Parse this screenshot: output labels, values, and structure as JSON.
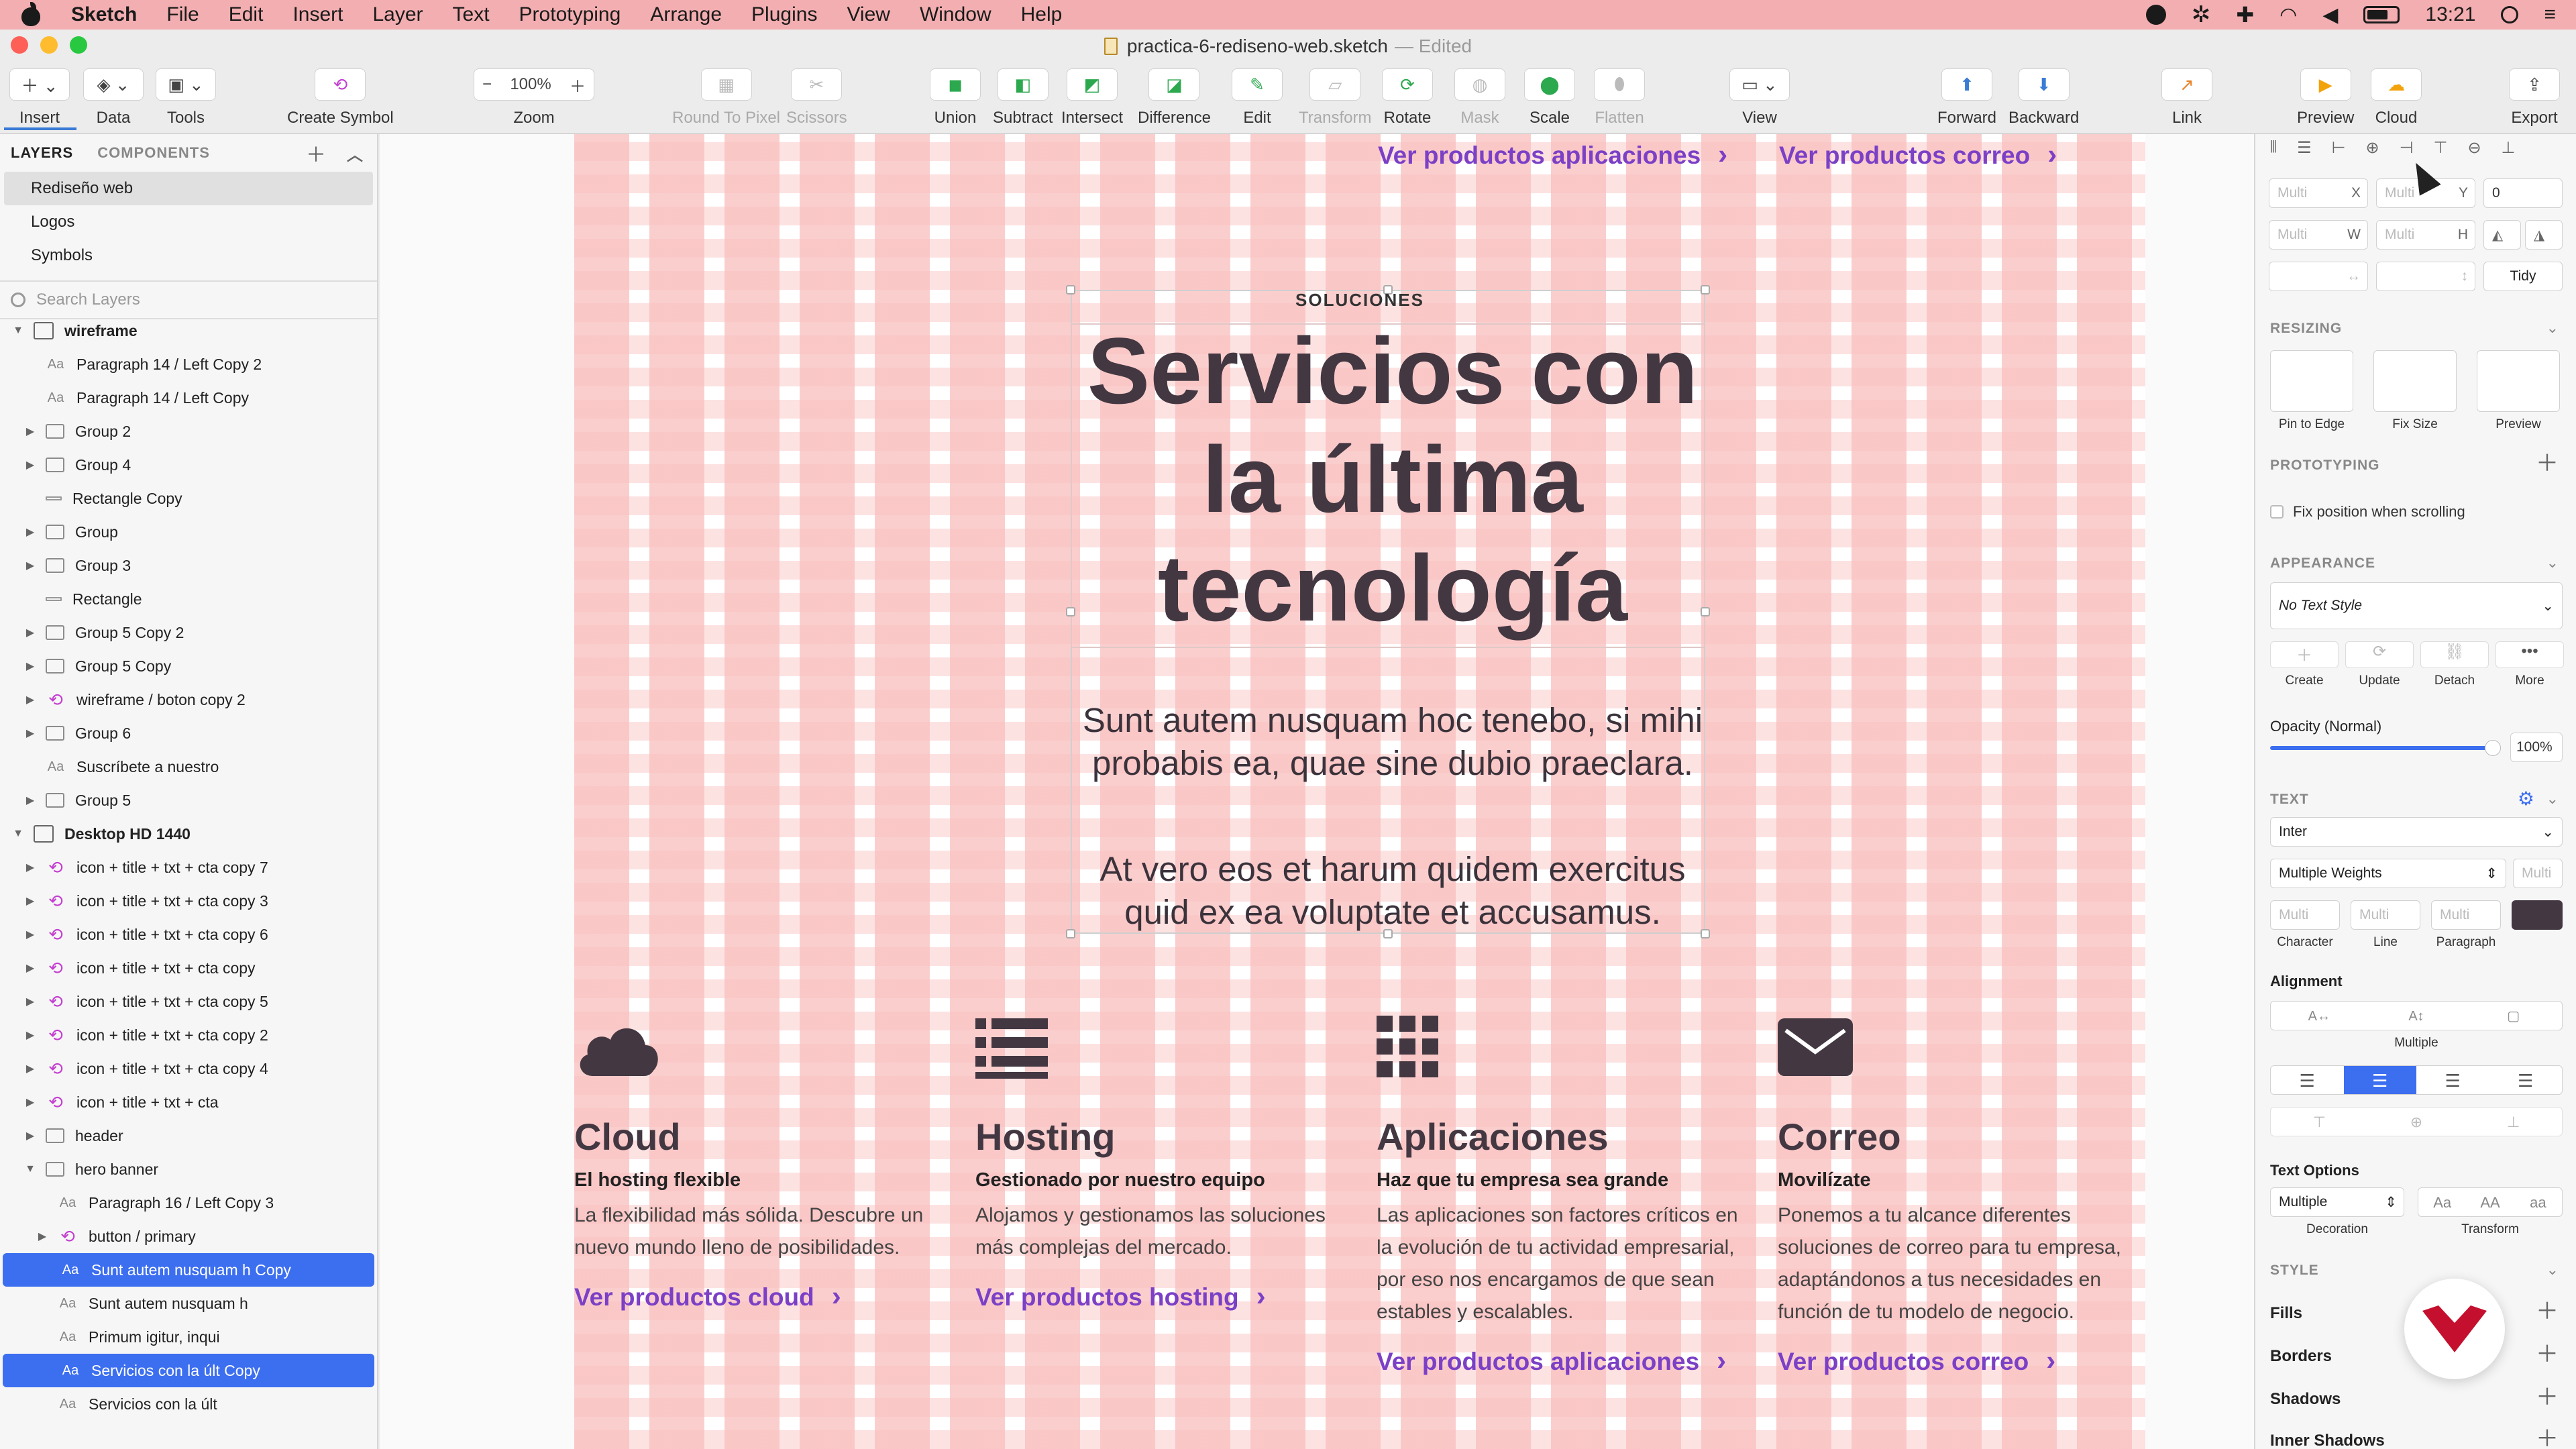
{
  "menubar": {
    "app": "Sketch",
    "items": [
      "File",
      "Edit",
      "Insert",
      "Layer",
      "Text",
      "Prototyping",
      "Arrange",
      "Plugins",
      "View",
      "Window",
      "Help"
    ],
    "time": "13:21"
  },
  "titlebar": {
    "filename": "practica-6-rediseno-web.sketch",
    "state": "— Edited"
  },
  "toolbar": {
    "insert": "Insert",
    "data": "Data",
    "tools": "Tools",
    "create_symbol": "Create Symbol",
    "zoom_value": "100%",
    "zoom": "Zoom",
    "round": "Round To Pixel",
    "scissors": "Scissors",
    "union": "Union",
    "subtract": "Subtract",
    "intersect": "Intersect",
    "difference": "Difference",
    "edit": "Edit",
    "transform": "Transform",
    "rotate": "Rotate",
    "mask": "Mask",
    "scale": "Scale",
    "flatten": "Flatten",
    "view": "View",
    "forward": "Forward",
    "backward": "Backward",
    "link": "Link",
    "preview": "Preview",
    "cloud": "Cloud",
    "export": "Export"
  },
  "layers_panel": {
    "tab_layers": "LAYERS",
    "tab_components": "COMPONENTS",
    "pages": [
      "Rediseño web",
      "Logos",
      "Symbols"
    ],
    "search_placeholder": "Search Layers",
    "layers": [
      {
        "name": "wireframe",
        "type": "artboard",
        "depth": 0,
        "open": true,
        "bold": true
      },
      {
        "name": "Paragraph 14 / Left Copy 2",
        "type": "text",
        "depth": 1
      },
      {
        "name": "Paragraph 14 / Left Copy",
        "type": "text",
        "depth": 1
      },
      {
        "name": "Group 2",
        "type": "group",
        "depth": 1
      },
      {
        "name": "Group 4",
        "type": "group",
        "depth": 1
      },
      {
        "name": "Rectangle Copy",
        "type": "rect",
        "depth": 1
      },
      {
        "name": "Group",
        "type": "group",
        "depth": 1
      },
      {
        "name": "Group 3",
        "type": "group",
        "depth": 1
      },
      {
        "name": "Rectangle",
        "type": "rect",
        "depth": 1
      },
      {
        "name": "Group 5 Copy 2",
        "type": "group",
        "depth": 1
      },
      {
        "name": "Group 5 Copy",
        "type": "group",
        "depth": 1
      },
      {
        "name": "wireframe / boton  copy 2",
        "type": "symbol",
        "depth": 1
      },
      {
        "name": "Group 6",
        "type": "group",
        "depth": 1
      },
      {
        "name": "Suscríbete a nuestro",
        "type": "text",
        "depth": 1
      },
      {
        "name": "Group 5",
        "type": "group",
        "depth": 1
      },
      {
        "name": "Desktop HD 1440",
        "type": "artboard",
        "depth": 0,
        "open": true,
        "bold": true
      },
      {
        "name": "icon + title + txt + cta copy 7",
        "type": "symbol",
        "depth": 1
      },
      {
        "name": "icon + title + txt + cta copy 3",
        "type": "symbol",
        "depth": 1
      },
      {
        "name": "icon + title + txt + cta copy 6",
        "type": "symbol",
        "depth": 1
      },
      {
        "name": "icon + title + txt + cta copy",
        "type": "symbol",
        "depth": 1
      },
      {
        "name": "icon + title + txt + cta copy 5",
        "type": "symbol",
        "depth": 1
      },
      {
        "name": "icon + title + txt + cta copy 2",
        "type": "symbol",
        "depth": 1
      },
      {
        "name": "icon + title + txt + cta copy 4",
        "type": "symbol",
        "depth": 1
      },
      {
        "name": "icon + title + txt + cta",
        "type": "symbol",
        "depth": 1
      },
      {
        "name": "header",
        "type": "group",
        "depth": 1
      },
      {
        "name": "hero banner",
        "type": "group",
        "depth": 1,
        "open": true
      },
      {
        "name": "Paragraph 16 / Left Copy 3",
        "type": "text",
        "depth": 2
      },
      {
        "name": "button / primary",
        "type": "symbol",
        "depth": 2,
        "collapsed": true
      },
      {
        "name": "Sunt autem nusquam h Copy",
        "type": "text",
        "depth": 2,
        "selected": true
      },
      {
        "name": "Sunt autem nusquam h",
        "type": "text",
        "depth": 2
      },
      {
        "name": "Primum igitur, inqui",
        "type": "text",
        "depth": 2
      },
      {
        "name": "Servicios con la últ Copy",
        "type": "text",
        "depth": 2,
        "selected": true
      },
      {
        "name": "Servicios con la últ",
        "type": "text",
        "depth": 2
      }
    ]
  },
  "artboard": {
    "top_links": [
      "Ver productos aplicaciones",
      "Ver productos correo"
    ],
    "eyebrow": "SOLUCIONES",
    "title": "Servicios con la última tecnología",
    "para1": "Sunt autem nusquam hoc tenebo, si mihi probabis ea, quae sine dubio praeclara.",
    "para2": "At vero eos et harum quidem exercitus quid ex ea voluptate et accusamus.",
    "cards": [
      {
        "icon": "cloud-icon",
        "title": "Cloud",
        "subtitle": "El hosting flexible",
        "text": "La flexibilidad más sólida. Descubre un nuevo mundo lleno de posibilidades.",
        "link": "Ver productos cloud"
      },
      {
        "icon": "server-list-icon",
        "title": "Hosting",
        "subtitle": "Gestionado por nuestro equipo",
        "text": "Alojamos y gestionamos las soluciones más complejas del mercado.",
        "link": "Ver productos hosting"
      },
      {
        "icon": "apps-grid-icon",
        "title": "Aplicaciones",
        "subtitle": "Haz que tu empresa sea grande",
        "text": "Las aplicaciones son factores críticos en la evolución de tu actividad empresarial, por eso nos encargamos de que sean estables y escalables.",
        "link": "Ver productos aplicaciones"
      },
      {
        "icon": "mail-envelope-icon",
        "title": "Correo",
        "subtitle": "Movilízate",
        "text": "Ponemos a tu alcance diferentes soluciones de correo para tu empresa, adaptándonos a tus necesidades en función de tu modelo de negocio.",
        "link": "Ver productos correo"
      }
    ]
  },
  "inspector": {
    "multi": "Multi",
    "x": "X",
    "y": "Y",
    "rot": "0",
    "w": "W",
    "h": "H",
    "tidy": "Tidy",
    "resizing": "RESIZING",
    "pin": "Pin to Edge",
    "fix": "Fix Size",
    "preview": "Preview",
    "prototyping": "PROTOTYPING",
    "fix_scroll": "Fix position when scrolling",
    "appearance": "APPEARANCE",
    "text_style": "No Text Style",
    "create": "Create",
    "update": "Update",
    "detach": "Detach",
    "more": "More",
    "opacity_label": "Opacity (Normal)",
    "opacity_value": "100%",
    "text": "TEXT",
    "font": "Inter",
    "weights": "Multiple Weights",
    "character": "Character",
    "line": "Line",
    "paragraph": "Paragraph",
    "alignment": "Alignment",
    "multiple": "Multiple",
    "text_options": "Text Options",
    "decoration_value": "Multiple",
    "decoration": "Decoration",
    "transform": "Transform",
    "case_aa": "Aa",
    "case_AA": "AA",
    "case_lower": "aa",
    "style": "STYLE",
    "fills": "Fills",
    "borders": "Borders",
    "shadows": "Shadows",
    "inner_shadows": "Inner Shadows"
  },
  "colors": {
    "menubar": "#f2aeb0",
    "accent": "#7b40c6",
    "title": "#433842",
    "selection": "#3c6ef0",
    "logo": "#c4102e"
  }
}
